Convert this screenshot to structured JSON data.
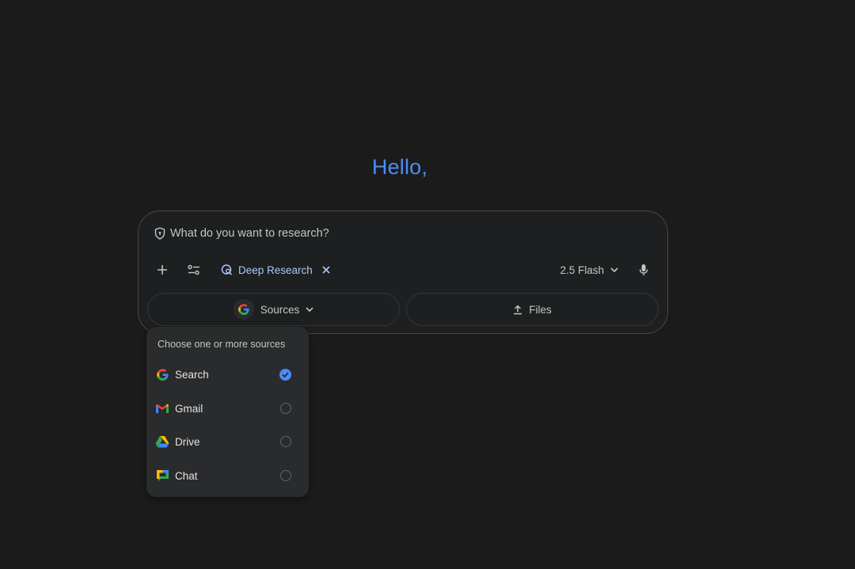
{
  "greeting": "Hello,",
  "composer": {
    "placeholder": "What do you want to research?",
    "chip_label": "Deep Research",
    "model_label": "2.5 Flash"
  },
  "buttons": {
    "sources_label": "Sources",
    "files_label": "Files"
  },
  "sources_menu": {
    "heading": "Choose one or more sources",
    "options": [
      {
        "label": "Search",
        "selected": true
      },
      {
        "label": "Gmail",
        "selected": false
      },
      {
        "label": "Drive",
        "selected": false
      },
      {
        "label": "Chat",
        "selected": false
      }
    ]
  },
  "colors": {
    "accent": "#4b8df8",
    "chip_text": "#a8c7fa",
    "background": "#1b1b1b"
  }
}
